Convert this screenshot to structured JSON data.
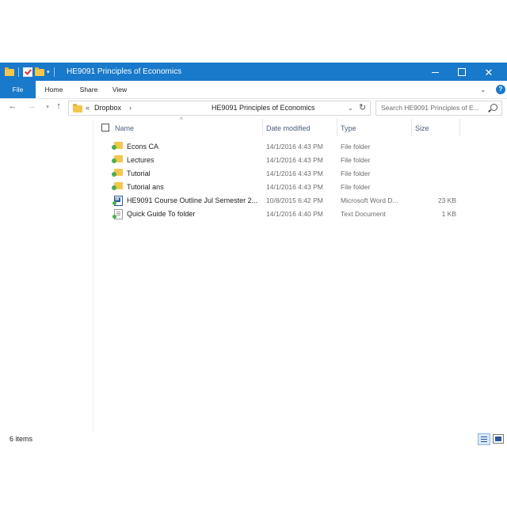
{
  "window": {
    "title": "HE9091 Principles of Economics",
    "controls": {
      "minimize": "minimize",
      "maximize": "maximize",
      "close": "close"
    }
  },
  "ribbon": {
    "tabs": [
      {
        "label": "File"
      },
      {
        "label": "Home"
      },
      {
        "label": "Share"
      },
      {
        "label": "View"
      }
    ]
  },
  "address": {
    "prefix": "«",
    "crumbs": [
      "Dropbox",
      "HE9091 Principles of Economics"
    ],
    "separator": "›"
  },
  "search": {
    "placeholder": "Search HE9091 Principles of E..."
  },
  "columns": {
    "name": "Name",
    "date": "Date modified",
    "type": "Type",
    "size": "Size"
  },
  "files": [
    {
      "name": "Econs CA",
      "date": "14/1/2016 4:43 PM",
      "type": "File folder",
      "size": "",
      "icon": "synced-folder-icon"
    },
    {
      "name": "Lectures",
      "date": "14/1/2016 4:43 PM",
      "type": "File folder",
      "size": "",
      "icon": "synced-folder-icon"
    },
    {
      "name": "Tutorial",
      "date": "14/1/2016 4:43 PM",
      "type": "File folder",
      "size": "",
      "icon": "synced-folder-icon"
    },
    {
      "name": "Tutorial ans",
      "date": "14/1/2016 4:43 PM",
      "type": "File folder",
      "size": "",
      "icon": "synced-folder-icon"
    },
    {
      "name": "HE9091 Course Outline Jul Semester 2...",
      "date": "10/8/2015 6:42 PM",
      "type": "Microsoft Word D...",
      "size": "23 KB",
      "icon": "word-document-icon"
    },
    {
      "name": "Quick Guide To folder",
      "date": "14/1/2016 4:40 PM",
      "type": "Text Document",
      "size": "1 KB",
      "icon": "text-document-icon"
    }
  ],
  "status": {
    "count": "6 items"
  },
  "colors": {
    "accent": "#1979ca",
    "folder": "#f3c64d",
    "sync": "#4cae4c"
  }
}
